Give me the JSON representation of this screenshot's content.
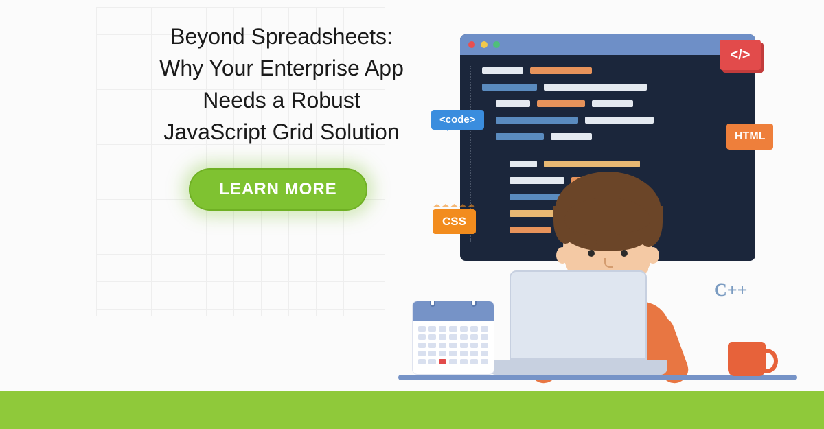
{
  "title": {
    "line1": "Beyond Spreadsheets:",
    "line2": "Why Your Enterprise App",
    "line3": "Needs a Robust",
    "line4": "JavaScript Grid Solution"
  },
  "cta_label": "LEARN MORE",
  "badges": {
    "code": "<code>",
    "css": "CSS",
    "html": "HTML",
    "slash": "</>",
    "cpp": "C++"
  },
  "colors": {
    "accent_green": "#7fc231",
    "footer_green": "#8fc93a",
    "editor_bg": "#1b263b",
    "orange": "#e87642",
    "blue": "#7693c7",
    "red": "#e24b4b"
  }
}
